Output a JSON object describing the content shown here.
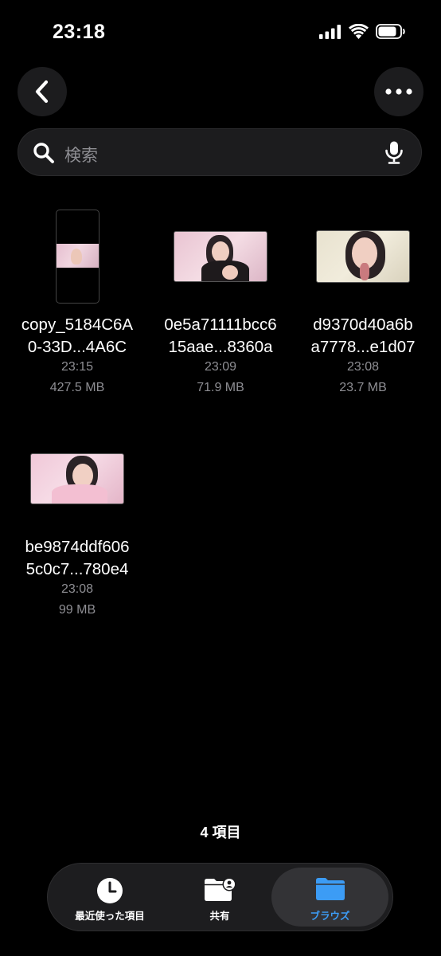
{
  "status_bar": {
    "time": "23:18"
  },
  "search": {
    "placeholder": "検索"
  },
  "files": [
    {
      "name_line1": "copy_5184C6A",
      "name_line2": "0-33D...4A6C",
      "time": "23:15",
      "size": "427.5 MB"
    },
    {
      "name_line1": "0e5a71111bcc6",
      "name_line2": "15aae...8360a",
      "time": "23:09",
      "size": "71.9 MB"
    },
    {
      "name_line1": "d9370d40a6b",
      "name_line2": "a7778...e1d07",
      "time": "23:08",
      "size": "23.7 MB"
    },
    {
      "name_line1": "be9874ddf606",
      "name_line2": "5c0c7...780e4",
      "time": "23:08",
      "size": "99 MB"
    }
  ],
  "item_count": "4 項目",
  "tabs": [
    {
      "label": "最近使った項目",
      "icon": "clock-icon"
    },
    {
      "label": "共有",
      "icon": "shared-folder-icon"
    },
    {
      "label": "ブラウズ",
      "icon": "folder-icon",
      "selected": true
    }
  ],
  "colors": {
    "accent": "#3c9cf5",
    "background": "#000000",
    "secondary_text": "#8e8e93"
  }
}
